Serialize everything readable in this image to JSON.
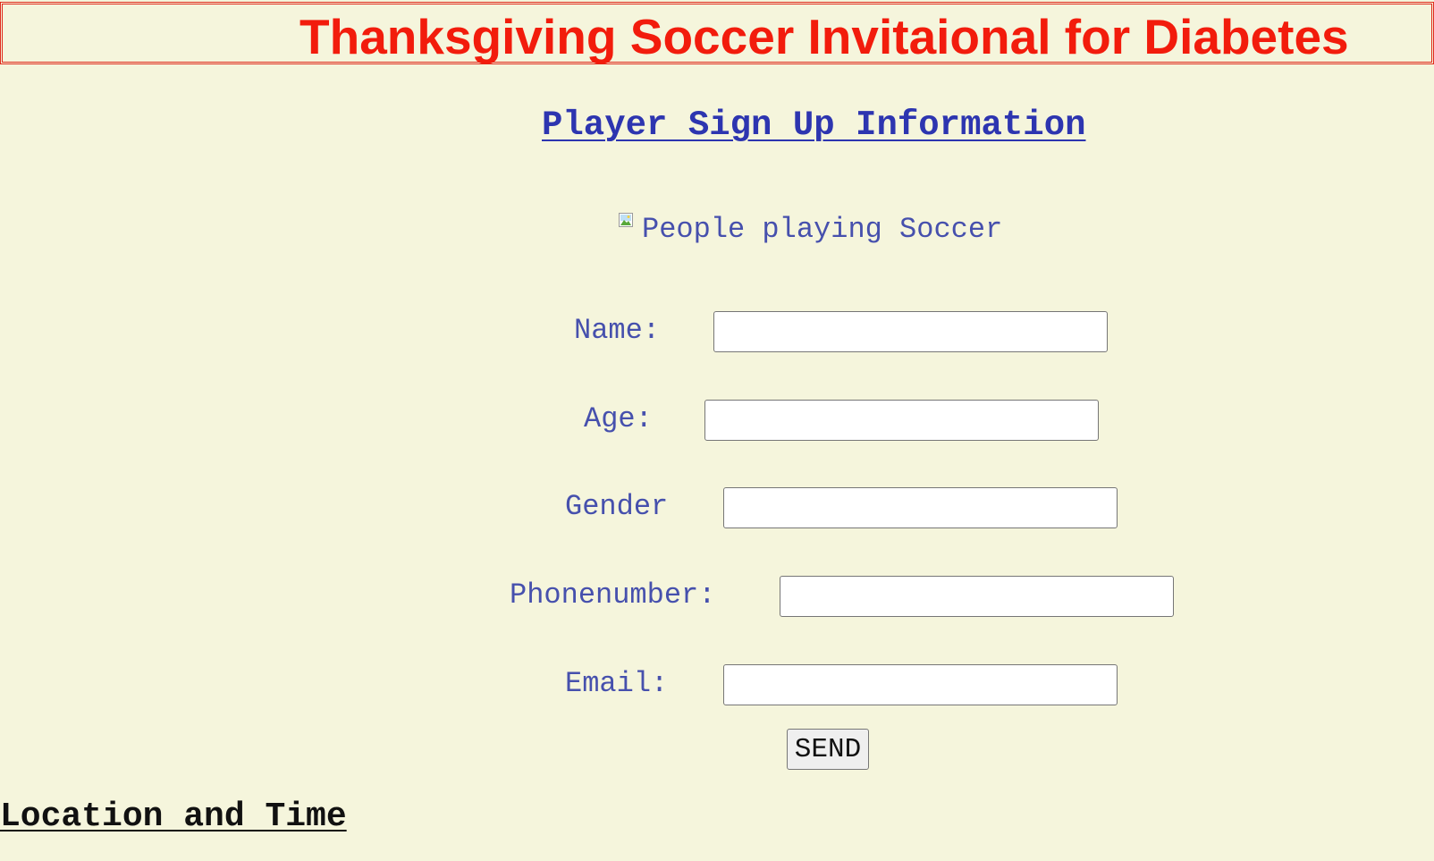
{
  "header": {
    "title": "Thanksgiving Soccer Invitaional for Diabetes"
  },
  "signup_link": {
    "label": "Player Sign Up Information"
  },
  "image": {
    "alt": "People playing Soccer"
  },
  "form": {
    "name_label": "Name:",
    "name_value": "",
    "age_label": "Age:",
    "age_value": "",
    "gender_label": "Gender",
    "gender_value": "",
    "phone_label": "Phonenumber:",
    "phone_value": "",
    "email_label": "Email:",
    "email_value": "",
    "submit_label": "SEND"
  },
  "location": {
    "heading": "Location and Time"
  },
  "colors": {
    "background": "#f5f5dc",
    "title_red": "#f21c0c",
    "link_blue": "#2d35b0",
    "label_blue": "#4650ad"
  }
}
